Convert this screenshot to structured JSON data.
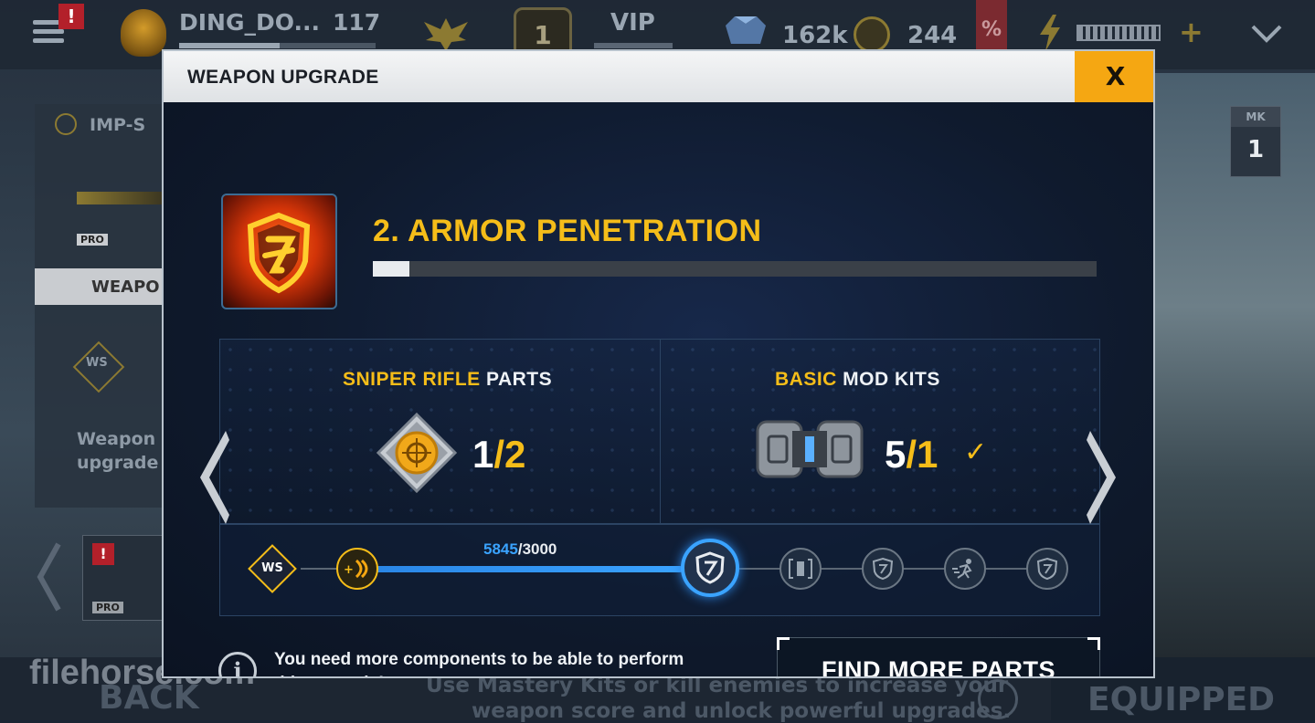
{
  "topbar": {
    "player_name": "DING_DO...",
    "level": "117",
    "rank_number": "1",
    "vip_label": "VIP",
    "currency_amount": "162k",
    "gold_amount": "244",
    "percent_label": "%",
    "plus_label": "+",
    "alert_mark": "!"
  },
  "background": {
    "weapon_name": "IMP-S",
    "pro_badge": "PRO",
    "weapon_tab": "WEAPO",
    "ws_label": "WS",
    "desc_line1": "Weapon",
    "desc_line2": "upgrade",
    "mk_label": "MK",
    "mk_value": "1",
    "back_label": "BACK",
    "hint_line1": "Use Mastery Kits or kill enemies to increase your",
    "hint_line2": "weapon score and unlock powerful upgrades.",
    "equipped_label": "EQUIPPED",
    "watermark": "filehorse.com"
  },
  "dialog": {
    "title": "WEAPON UPGRADE",
    "close_label": "X",
    "upgrade_title": "2. ARMOR PENETRATION",
    "progress_fraction": 0.05,
    "parts": [
      {
        "accent": "SNIPER RIFLE",
        "label": " PARTS",
        "have": "1",
        "sep": "/",
        "need": "2",
        "met": false
      },
      {
        "accent": "BASIC",
        "label": " MOD KITS",
        "have": "5",
        "sep": "/",
        "need": "1",
        "met": true
      }
    ],
    "check_mark": "✓",
    "track": {
      "ws_label": "WS",
      "xp_current": "5845",
      "xp_sep": "/",
      "xp_target": "3000"
    },
    "info_icon": "i",
    "info_text": "You need more components to be able to perform this upgrade!",
    "find_button": "FIND MORE PARTS"
  },
  "colors": {
    "accent_yellow": "#f5bd19",
    "close_orange": "#f5a712",
    "track_blue": "#3aa3ff"
  },
  "icons": [
    "hamburger-icon",
    "bulldog-icon",
    "eagle-icon",
    "rank-icon",
    "diamond-icon",
    "gold-coin-icon",
    "lightning-icon",
    "chevron-down-icon",
    "armor-shield-icon",
    "sniper-part-icon",
    "mod-kit-icon",
    "left-arrow-icon",
    "right-arrow-icon",
    "info-icon"
  ]
}
